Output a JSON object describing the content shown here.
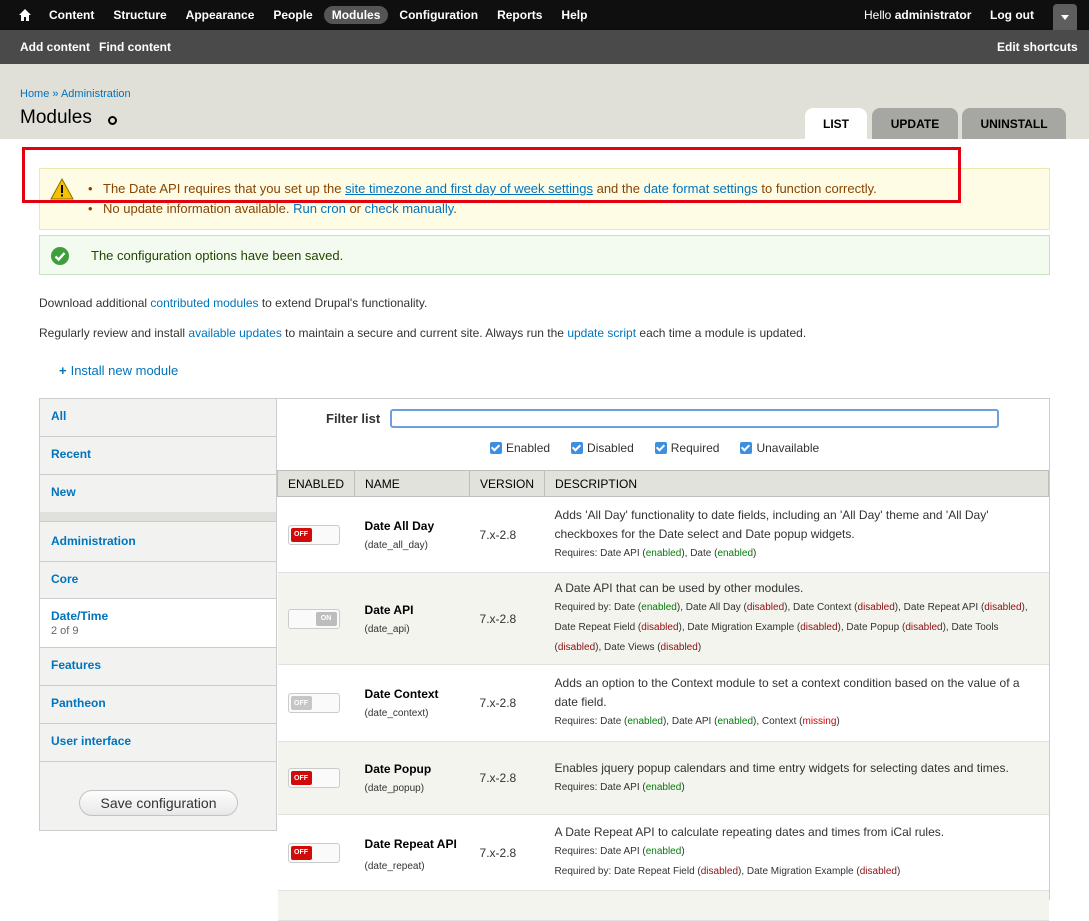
{
  "toolbar": {
    "menu": [
      "Content",
      "Structure",
      "Appearance",
      "People",
      "Modules",
      "Configuration",
      "Reports",
      "Help"
    ],
    "active": "Modules",
    "greeting": "Hello",
    "username": "administrator",
    "logout": "Log out"
  },
  "shortcuts": {
    "add_content": "Add content",
    "find_content": "Find content",
    "edit": "Edit shortcuts"
  },
  "breadcrumb": "Home » Administration",
  "page_title": "Modules",
  "tabs": {
    "list": "List",
    "update": "Update",
    "uninstall": "Uninstall"
  },
  "warning": {
    "line1_pre": "The Date API requires that you set up the",
    "link1": "site timezone and first day of week settings",
    "line1_mid": "and the",
    "link2": "date format settings",
    "line1_post": "to function correctly.",
    "line2_pre": "No update information available.",
    "link3": "Run cron",
    "line2_mid": "or",
    "link4": "check manually",
    "line2_post": "."
  },
  "status": "The configuration options have been saved.",
  "intro1": {
    "pre": "Download additional",
    "link": "contributed modules",
    "post": "to extend Drupal's functionality."
  },
  "intro2": {
    "pre": "Regularly review and install",
    "link1": "available updates",
    "mid": "to maintain a secure and current site. Always run the",
    "link2": "update script",
    "post": "each time a module is updated."
  },
  "install_link": "Install new module",
  "vtabs": {
    "all": "All",
    "recent": "Recent",
    "new": "New",
    "administration": "Administration",
    "core": "Core",
    "datetime": "Date/Time",
    "datetime_summary": "2 of 9",
    "features": "Features",
    "pantheon": "Pantheon",
    "user_interface": "User interface",
    "save": "Save configuration"
  },
  "filter": {
    "label": "Filter list",
    "enabled": "Enabled",
    "disabled": "Disabled",
    "required": "Required",
    "unavailable": "Unavailable"
  },
  "table": {
    "headers": [
      "ENABLED",
      "NAME",
      "VERSION",
      "DESCRIPTION"
    ],
    "off": "OFF",
    "on": "ON",
    "modules": [
      {
        "name": "Date All Day",
        "machine": "(date_all_day)",
        "version": "7.x-2.8",
        "desc": "Adds 'All Day' functionality to date fields, including an 'All Day' theme and 'All Day' checkboxes for the Date select and Date popup widgets.",
        "req_label": "Requires:",
        "req": "Date API (enabled), Date (enabled)"
      },
      {
        "name": "Date API",
        "machine": "(date_api)",
        "version": "7.x-2.8",
        "desc": "A Date API that can be used by other modules.",
        "req_label": "Required by:",
        "req": "Date (enabled), Date All Day (disabled), Date Context (disabled), Date Repeat API (disabled), Date Repeat Field (disabled), Date Migration Example (disabled), Date Popup (disabled), Date Tools (disabled), Date Views (disabled)"
      },
      {
        "name": "Date Context",
        "machine": "(date_context)",
        "version": "7.x-2.8",
        "desc": "Adds an option to the Context module to set a context condition based on the value of a date field.",
        "req_label": "Requires:",
        "req": "Date (enabled), Date API (enabled), Context (missing)"
      },
      {
        "name": "Date Popup",
        "machine": "(date_popup)",
        "version": "7.x-2.8",
        "desc": "Enables jquery popup calendars and time entry widgets for selecting dates and times.",
        "req_label": "Requires:",
        "req": "Date API (enabled)"
      },
      {
        "name": "Date Repeat API",
        "machine": "(date_repeat)",
        "version": "7.x-2.8",
        "desc": "A Date Repeat API to calculate repeating dates and times from iCal rules.",
        "req_label": "Requires:",
        "req": "Date API (enabled)",
        "req2_label": "Required by:",
        "req2": "Date Repeat Field (disabled), Date Migration Example (disabled)"
      }
    ]
  },
  "colors": {
    "toolbar": "#0f0f0f",
    "link": "#0074bd",
    "toggle_off": "#d10a0a",
    "enabled": "#077a0b",
    "disabled": "#8c1010",
    "missing": "#cc0000",
    "highlight_box": "#e3000f"
  }
}
